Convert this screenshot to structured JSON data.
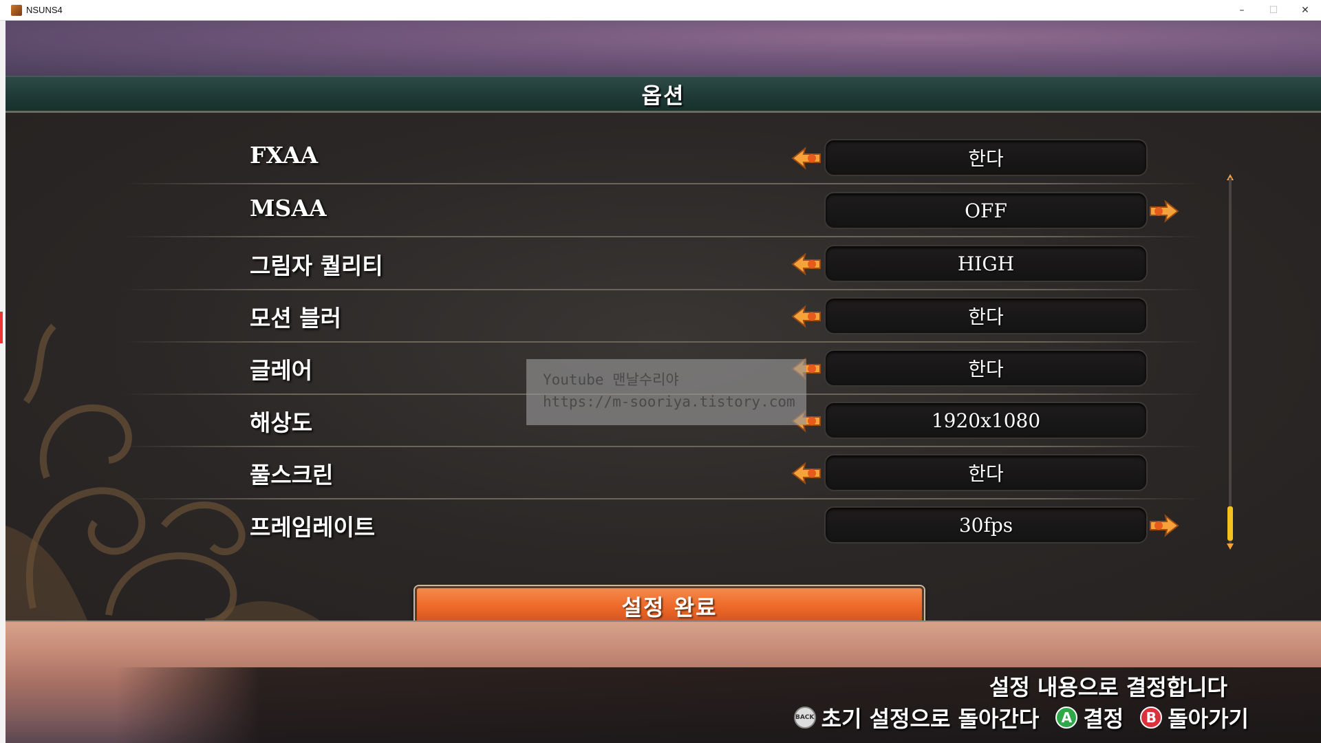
{
  "window": {
    "title": "NSUNS4",
    "minimize": "–",
    "maximize": "☐",
    "close": "✕"
  },
  "header": {
    "title": "옵션"
  },
  "options": [
    {
      "label": "FXAA",
      "value": "한다",
      "left_arrow": true,
      "right_arrow": false
    },
    {
      "label": "MSAA",
      "value": "OFF",
      "left_arrow": false,
      "right_arrow": true
    },
    {
      "label": "그림자 퀄리티",
      "value": "HIGH",
      "left_arrow": true,
      "right_arrow": false
    },
    {
      "label": "모션 블러",
      "value": "한다",
      "left_arrow": true,
      "right_arrow": false
    },
    {
      "label": "글레어",
      "value": "한다",
      "left_arrow": true,
      "right_arrow": false
    },
    {
      "label": "해상도",
      "value": "1920x1080",
      "left_arrow": true,
      "right_arrow": false
    },
    {
      "label": "풀스크린",
      "value": "한다",
      "left_arrow": true,
      "right_arrow": false
    },
    {
      "label": "프레임레이트",
      "value": "30fps",
      "left_arrow": false,
      "right_arrow": true
    }
  ],
  "confirm_button": "설정 완료",
  "help": {
    "description": "설정 내용으로 결정합니다",
    "back_glyph": "BACK",
    "reset_label": "초기 설정으로 돌아간다",
    "a_glyph": "A",
    "confirm_label": "결정",
    "b_glyph": "B",
    "back_label": "돌아가기"
  },
  "watermark": {
    "line1": "Youtube 맨날수리야",
    "line2": "https://m-sooriya.tistory.com"
  },
  "colors": {
    "accent_orange": "#ee6a2a",
    "arrow_orange": "#f5a23a",
    "header_teal": "#1f3a36",
    "scroll_thumb": "#f3c21e"
  }
}
